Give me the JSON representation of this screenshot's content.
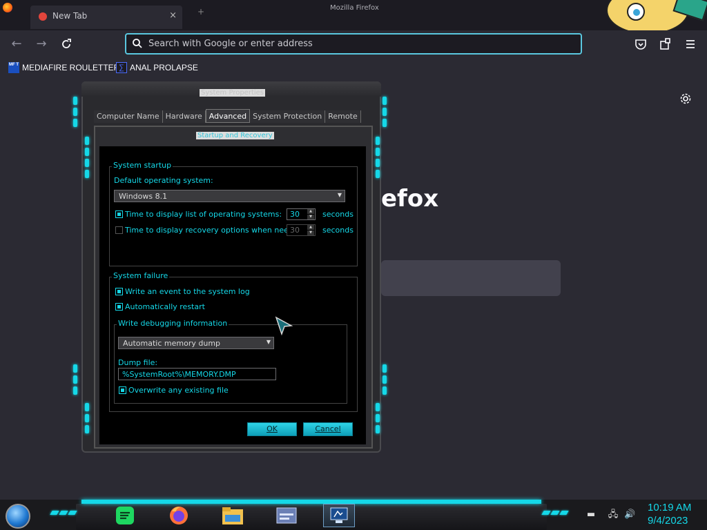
{
  "browser": {
    "window_title": "Mozilla Firefox",
    "tab_title": "New Tab",
    "tab_close": "×",
    "urlbar_placeholder": "Search with Google or enter address",
    "bookmarks": [
      {
        "label": "MEDIAFIRE ROULETTER",
        "icon": "mediafire-icon",
        "favicon_text": "MF T"
      },
      {
        "label": "ANAL PROLAPSE",
        "icon": "bookmark-site-icon",
        "favicon_text": "∑"
      }
    ],
    "newtab_heading_fragment": "efox"
  },
  "system_properties": {
    "title": "System Properties",
    "tabs": [
      {
        "label": "Computer Name",
        "selected": false
      },
      {
        "label": "Hardware",
        "selected": false
      },
      {
        "label": "Advanced",
        "selected": true
      },
      {
        "label": "System Protection",
        "selected": false
      },
      {
        "label": "Remote",
        "selected": false
      }
    ]
  },
  "startup_recovery": {
    "title": "Startup and Recovery",
    "system_startup": {
      "group_label": "System startup",
      "default_os_label": "Default operating system:",
      "default_os_value": "Windows 8.1",
      "display_list_label": "Time to display list of operating systems:",
      "display_list_checked": true,
      "display_list_value": "30",
      "recovery_label": "Time to display recovery options when needed:",
      "recovery_checked": false,
      "recovery_value": "30",
      "seconds_label": "seconds"
    },
    "system_failure": {
      "group_label": "System failure",
      "write_event_label": "Write an event to the system log",
      "write_event_checked": true,
      "auto_restart_label": "Automatically restart",
      "auto_restart_checked": true,
      "debug_group_label": "Write debugging information",
      "debug_type_value": "Automatic memory dump",
      "dump_file_label": "Dump file:",
      "dump_file_value": "%SystemRoot%\\MEMORY.DMP",
      "overwrite_label": "Overwrite any existing file",
      "overwrite_checked": true
    },
    "buttons": {
      "ok": "OK",
      "cancel": "Cancel"
    }
  },
  "taskbar": {
    "apps": [
      {
        "name": "spotify",
        "active": false
      },
      {
        "name": "firefox",
        "active": false
      },
      {
        "name": "file-explorer",
        "active": false
      },
      {
        "name": "control-panel",
        "active": false
      },
      {
        "name": "system-properties",
        "active": true
      }
    ],
    "clock_time": "10:19 AM",
    "clock_date": "9/4/2023"
  },
  "colors": {
    "accent": "#15d8e8",
    "browser_bg": "#2b2a33",
    "urlbar_focus": "#5ac8e0"
  }
}
